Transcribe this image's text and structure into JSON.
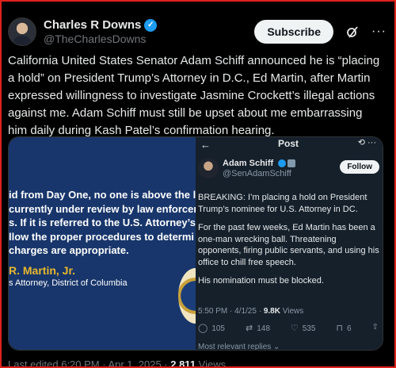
{
  "header": {
    "name": "Charles R Downs",
    "handle": "@TheCharlesDowns",
    "subscribe_label": "Subscribe",
    "grok_icon": "grok-icon",
    "more_icon": "more-icon"
  },
  "tweet": {
    "text": "California United States Senator Adam Schiff announced he is “placing a hold” on President Trump’s Attorney in D.C., Ed Martin, after Martin expressed willingness to investigate Jasmine Crockett’s illegal actions against me. Adam Schiff must still be upset about me embarrassing him daily during Kash Patel’s confirmation hearing."
  },
  "media_left": {
    "lines": [
      "id from Day One, no one is above the la",
      "currently under review by law enforcer",
      "s. If it is referred to the U.S. Attorney’s",
      "llow the proper procedures to determi",
      "charges are appropriate."
    ],
    "signer_name": "R. Martin, Jr.",
    "signer_title": "s Attorney, District of Columbia"
  },
  "media_right": {
    "post_title": "Post",
    "name": "Adam Schiff",
    "handle": "@SenAdamSchiff",
    "follow_label": "Follow",
    "paragraphs": [
      "BREAKING: I’m placing a hold on President Trump’s nominee for U.S. Attorney in DC.",
      "For the past few weeks, Ed Martin has been a one-man wrecking ball. Threatening opponents, firing public servants, and using his office to chill free speech.",
      "His nomination must be blocked."
    ],
    "meta_time": "5:50 PM · 4/1/25 · ",
    "meta_views": "9.8K",
    "meta_views_label": " Views",
    "actions": {
      "replies": "105",
      "reposts": "148",
      "likes": "535",
      "bookmarks": "6"
    },
    "more_replies": "Most relevant replies ⌄"
  },
  "footer": {
    "edited": "Last edited 6:20 PM · Apr 1, 2025 · ",
    "views": "2,811",
    "views_label": " Views"
  }
}
